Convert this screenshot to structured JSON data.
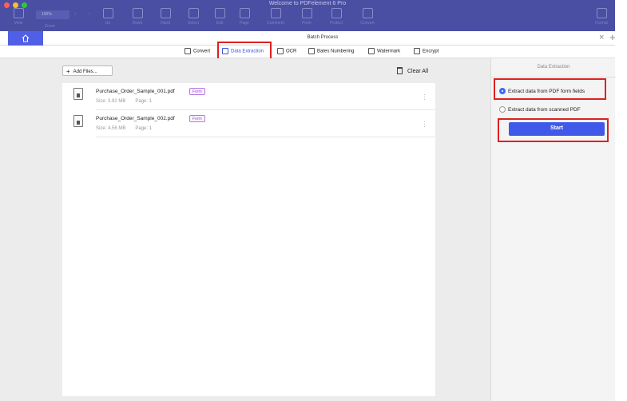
{
  "window": {
    "title": "Welcome to PDFelement 6 Pro"
  },
  "toolbar": {
    "zoom_value": "100%",
    "zoom_label": "Zoom",
    "items": [
      {
        "label": "View",
        "icon": "view-icon"
      },
      {
        "label": "Hand",
        "icon": "hand-icon"
      },
      {
        "label": "Select",
        "icon": "select-icon"
      },
      {
        "label": "Edit",
        "icon": "edit-icon"
      },
      {
        "label": "Page",
        "icon": "page-icon"
      },
      {
        "label": "Comment",
        "icon": "comment-icon"
      },
      {
        "label": "Form",
        "icon": "form-icon"
      },
      {
        "label": "Protect",
        "icon": "protect-icon"
      },
      {
        "label": "Convert",
        "icon": "convert-icon"
      },
      {
        "label": "Format",
        "icon": "format-icon"
      }
    ]
  },
  "tab": {
    "title": "Batch Process",
    "home_icon": "home-icon"
  },
  "features": [
    {
      "label": "Convert",
      "icon": "convert-icon",
      "active": false
    },
    {
      "label": "Data Extraction",
      "icon": "data-extraction-icon",
      "active": true
    },
    {
      "label": "OCR",
      "icon": "ocr-icon",
      "active": false
    },
    {
      "label": "Bates Numbering",
      "icon": "bates-numbering-icon",
      "active": false
    },
    {
      "label": "Watermark",
      "icon": "watermark-icon",
      "active": false
    },
    {
      "label": "Encrypt",
      "icon": "encrypt-icon",
      "active": false
    }
  ],
  "actions": {
    "add_files": "Add Files...",
    "clear_all": "Clear All"
  },
  "files": [
    {
      "name": "Purchase_Order_Sample_001.pdf",
      "badge": "Form",
      "size": "Size: 3.92 MB",
      "pages": "Page: 1"
    },
    {
      "name": "Purchase_Order_Sample_002.pdf",
      "badge": "Form",
      "size": "Size: 4.56 MB",
      "pages": "Page: 1"
    }
  ],
  "panel": {
    "title": "Data Extraction",
    "options": [
      {
        "label": "Extract data from PDF form fields",
        "selected": true
      },
      {
        "label": "Extract data from scanned PDF",
        "selected": false
      }
    ],
    "start_label": "Start"
  },
  "colors": {
    "titlebar": "#4b4fa3",
    "accent": "#4059e9",
    "highlight": "#e02020",
    "form_badge": "#9a4fd8"
  }
}
